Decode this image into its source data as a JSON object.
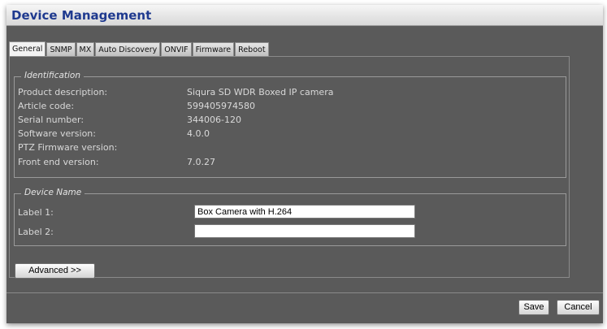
{
  "window": {
    "title": "Device Management"
  },
  "tabs": [
    {
      "label": "General",
      "active": true
    },
    {
      "label": "SNMP",
      "active": false
    },
    {
      "label": "MX",
      "active": false
    },
    {
      "label": "Auto Discovery",
      "active": false
    },
    {
      "label": "ONVIF",
      "active": false
    },
    {
      "label": "Firmware",
      "active": false
    },
    {
      "label": "Reboot",
      "active": false
    }
  ],
  "identification": {
    "legend": "Identification",
    "rows": [
      {
        "label": "Product description:",
        "value": "Siqura SD WDR Boxed IP camera"
      },
      {
        "label": "Article code:",
        "value": "599405974580"
      },
      {
        "label": "Serial number:",
        "value": "344006-120"
      },
      {
        "label": "Software version:",
        "value": "4.0.0"
      },
      {
        "label": "PTZ Firmware version:",
        "value": ""
      },
      {
        "label": "Front end version:",
        "value": "7.0.27"
      }
    ]
  },
  "device_name": {
    "legend": "Device Name",
    "label1": "Label 1:",
    "label1_value": "Box Camera with H.264",
    "label2": "Label 2:",
    "label2_value": ""
  },
  "buttons": {
    "advanced": "Advanced >>",
    "save": "Save",
    "cancel": "Cancel"
  },
  "colors": {
    "title": "#1f3a8f",
    "window_bg": "#5a5a5a",
    "text": "#d9d9d9"
  }
}
